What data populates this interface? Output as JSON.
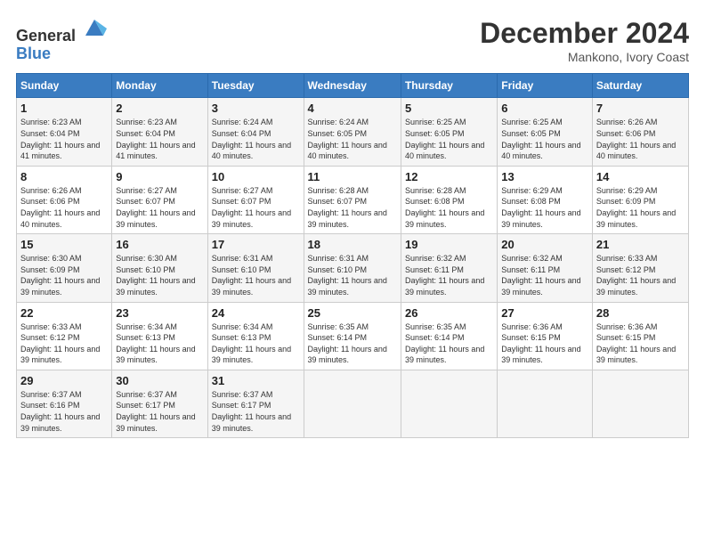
{
  "header": {
    "logo_general": "General",
    "logo_blue": "Blue",
    "month": "December 2024",
    "location": "Mankono, Ivory Coast"
  },
  "days_of_week": [
    "Sunday",
    "Monday",
    "Tuesday",
    "Wednesday",
    "Thursday",
    "Friday",
    "Saturday"
  ],
  "weeks": [
    [
      {
        "day": "1",
        "sunrise": "6:23 AM",
        "sunset": "6:04 PM",
        "daylight": "11 hours and 41 minutes."
      },
      {
        "day": "2",
        "sunrise": "6:23 AM",
        "sunset": "6:04 PM",
        "daylight": "11 hours and 41 minutes."
      },
      {
        "day": "3",
        "sunrise": "6:24 AM",
        "sunset": "6:04 PM",
        "daylight": "11 hours and 40 minutes."
      },
      {
        "day": "4",
        "sunrise": "6:24 AM",
        "sunset": "6:05 PM",
        "daylight": "11 hours and 40 minutes."
      },
      {
        "day": "5",
        "sunrise": "6:25 AM",
        "sunset": "6:05 PM",
        "daylight": "11 hours and 40 minutes."
      },
      {
        "day": "6",
        "sunrise": "6:25 AM",
        "sunset": "6:05 PM",
        "daylight": "11 hours and 40 minutes."
      },
      {
        "day": "7",
        "sunrise": "6:26 AM",
        "sunset": "6:06 PM",
        "daylight": "11 hours and 40 minutes."
      }
    ],
    [
      {
        "day": "8",
        "sunrise": "6:26 AM",
        "sunset": "6:06 PM",
        "daylight": "11 hours and 40 minutes."
      },
      {
        "day": "9",
        "sunrise": "6:27 AM",
        "sunset": "6:07 PM",
        "daylight": "11 hours and 39 minutes."
      },
      {
        "day": "10",
        "sunrise": "6:27 AM",
        "sunset": "6:07 PM",
        "daylight": "11 hours and 39 minutes."
      },
      {
        "day": "11",
        "sunrise": "6:28 AM",
        "sunset": "6:07 PM",
        "daylight": "11 hours and 39 minutes."
      },
      {
        "day": "12",
        "sunrise": "6:28 AM",
        "sunset": "6:08 PM",
        "daylight": "11 hours and 39 minutes."
      },
      {
        "day": "13",
        "sunrise": "6:29 AM",
        "sunset": "6:08 PM",
        "daylight": "11 hours and 39 minutes."
      },
      {
        "day": "14",
        "sunrise": "6:29 AM",
        "sunset": "6:09 PM",
        "daylight": "11 hours and 39 minutes."
      }
    ],
    [
      {
        "day": "15",
        "sunrise": "6:30 AM",
        "sunset": "6:09 PM",
        "daylight": "11 hours and 39 minutes."
      },
      {
        "day": "16",
        "sunrise": "6:30 AM",
        "sunset": "6:10 PM",
        "daylight": "11 hours and 39 minutes."
      },
      {
        "day": "17",
        "sunrise": "6:31 AM",
        "sunset": "6:10 PM",
        "daylight": "11 hours and 39 minutes."
      },
      {
        "day": "18",
        "sunrise": "6:31 AM",
        "sunset": "6:10 PM",
        "daylight": "11 hours and 39 minutes."
      },
      {
        "day": "19",
        "sunrise": "6:32 AM",
        "sunset": "6:11 PM",
        "daylight": "11 hours and 39 minutes."
      },
      {
        "day": "20",
        "sunrise": "6:32 AM",
        "sunset": "6:11 PM",
        "daylight": "11 hours and 39 minutes."
      },
      {
        "day": "21",
        "sunrise": "6:33 AM",
        "sunset": "6:12 PM",
        "daylight": "11 hours and 39 minutes."
      }
    ],
    [
      {
        "day": "22",
        "sunrise": "6:33 AM",
        "sunset": "6:12 PM",
        "daylight": "11 hours and 39 minutes."
      },
      {
        "day": "23",
        "sunrise": "6:34 AM",
        "sunset": "6:13 PM",
        "daylight": "11 hours and 39 minutes."
      },
      {
        "day": "24",
        "sunrise": "6:34 AM",
        "sunset": "6:13 PM",
        "daylight": "11 hours and 39 minutes."
      },
      {
        "day": "25",
        "sunrise": "6:35 AM",
        "sunset": "6:14 PM",
        "daylight": "11 hours and 39 minutes."
      },
      {
        "day": "26",
        "sunrise": "6:35 AM",
        "sunset": "6:14 PM",
        "daylight": "11 hours and 39 minutes."
      },
      {
        "day": "27",
        "sunrise": "6:36 AM",
        "sunset": "6:15 PM",
        "daylight": "11 hours and 39 minutes."
      },
      {
        "day": "28",
        "sunrise": "6:36 AM",
        "sunset": "6:15 PM",
        "daylight": "11 hours and 39 minutes."
      }
    ],
    [
      {
        "day": "29",
        "sunrise": "6:37 AM",
        "sunset": "6:16 PM",
        "daylight": "11 hours and 39 minutes."
      },
      {
        "day": "30",
        "sunrise": "6:37 AM",
        "sunset": "6:17 PM",
        "daylight": "11 hours and 39 minutes."
      },
      {
        "day": "31",
        "sunrise": "6:37 AM",
        "sunset": "6:17 PM",
        "daylight": "11 hours and 39 minutes."
      },
      null,
      null,
      null,
      null
    ]
  ]
}
